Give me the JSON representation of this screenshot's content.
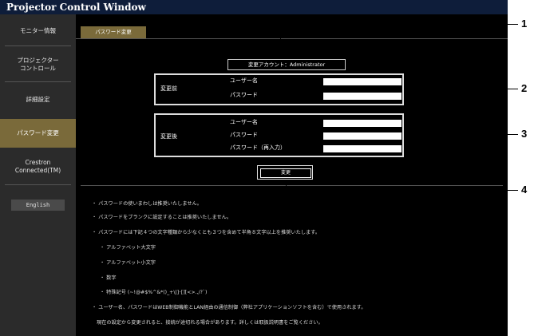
{
  "window": {
    "title": "Projector Control Window"
  },
  "sidebar": {
    "items": [
      {
        "label": "モニター情報"
      },
      {
        "label": "プロジェクター\nコントロール"
      },
      {
        "label": "詳細設定"
      },
      {
        "label": "パスワード変更"
      },
      {
        "label": "Crestron\nConnected(TM)"
      }
    ],
    "english_label": "English"
  },
  "tab": {
    "label": "パスワード変更"
  },
  "account": {
    "label": "変更アカウント：Administrator"
  },
  "before": {
    "label": "変更前",
    "username_label": "ユーザー名",
    "password_label": "パスワード",
    "username_value": "",
    "password_value": ""
  },
  "after": {
    "label": "変更後",
    "username_label": "ユーザー名",
    "password_label": "パスワード",
    "password_confirm_label": "パスワード（再入力）",
    "username_value": "",
    "password_value": "",
    "password_confirm_value": ""
  },
  "submit": {
    "label": "変更"
  },
  "notes": [
    "・ パスワードの使いまわしは推奨いたしません。",
    "・ パスワードをブランクに設定することは推奨いたしません。",
    "・ パスワードには下記４つの文字種類から少なくとも３つを含めて半角８文字以上を推奨いたします。",
    "・ アルファベット大文字",
    "・ アルファベット小文字",
    "・ 数字",
    "・ 特殊記号 (~!@#$%^&*()_+\\|}{][<>.,/?`)",
    "・ ユーザー名、パスワードはWEB制御機能とLAN経由の通信制御（弊社アプリケーションソフトを含む）で使用されます。",
    "現在の設定から変更されると、接続が途切れる場合があります。詳しくは取扱説明書をご覧ください。"
  ],
  "callouts": [
    "1",
    "2",
    "3",
    "4"
  ],
  "colors": {
    "active_bg": "#7a6a3a",
    "titlebar_bg": "#0e1d3a"
  }
}
